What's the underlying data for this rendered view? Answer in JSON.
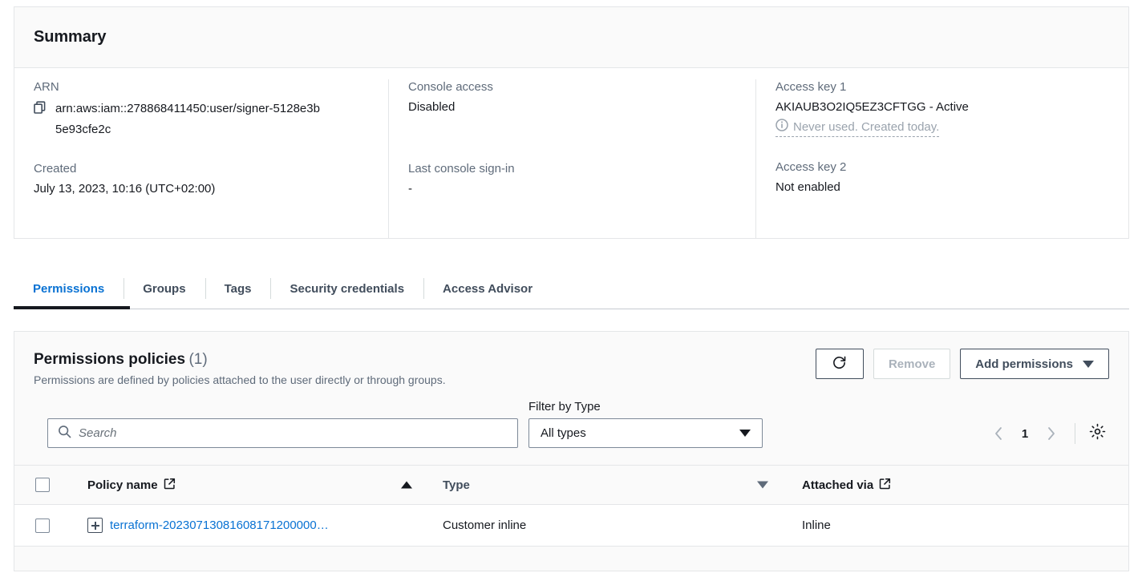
{
  "summary": {
    "title": "Summary",
    "fields": {
      "arn_label": "ARN",
      "arn_value": "arn:aws:iam::278868411450:user/signer-5128e3b5e93cfe2c",
      "created_label": "Created",
      "created_value": "July 13, 2023, 10:16 (UTC+02:00)",
      "console_access_label": "Console access",
      "console_access_value": "Disabled",
      "last_signin_label": "Last console sign-in",
      "last_signin_value": "-",
      "access_key_1_label": "Access key 1",
      "access_key_1_value": "AKIAUB3O2IQ5EZ3CFTGG - Active",
      "access_key_1_hint": "Never used. Created today.",
      "access_key_2_label": "Access key 2",
      "access_key_2_value": "Not enabled"
    }
  },
  "tabs": [
    {
      "label": "Permissions",
      "active": true
    },
    {
      "label": "Groups",
      "active": false
    },
    {
      "label": "Tags",
      "active": false
    },
    {
      "label": "Security credentials",
      "active": false
    },
    {
      "label": "Access Advisor",
      "active": false
    }
  ],
  "permissions": {
    "title": "Permissions policies",
    "count": "(1)",
    "description": "Permissions are defined by policies attached to the user directly or through groups.",
    "actions": {
      "refresh_icon": "refresh-icon",
      "remove_label": "Remove",
      "add_label": "Add permissions"
    },
    "search": {
      "placeholder": "Search",
      "value": "",
      "icon": "search-icon"
    },
    "filter": {
      "label": "Filter by Type",
      "selected": "All types"
    },
    "pagination": {
      "prev_icon": "chevron-left-icon",
      "page": "1",
      "next_icon": "chevron-right-icon",
      "settings_icon": "gear-icon"
    },
    "table": {
      "columns": [
        {
          "label": "Policy name",
          "external": true,
          "sort": "asc"
        },
        {
          "label": "Type",
          "external": false,
          "sort": "desc"
        },
        {
          "label": "Attached via",
          "external": true,
          "sort": "none"
        }
      ],
      "rows": [
        {
          "selected": false,
          "policy_name": "terraform-20230713081608171200000…",
          "type": "Customer inline",
          "attached_via": "Inline"
        }
      ]
    }
  },
  "colors": {
    "link": "#0972d3",
    "text": "#16191f",
    "muted": "#5f6b7a",
    "border": "#e4e6e8",
    "panel_bg": "#fafafa"
  }
}
